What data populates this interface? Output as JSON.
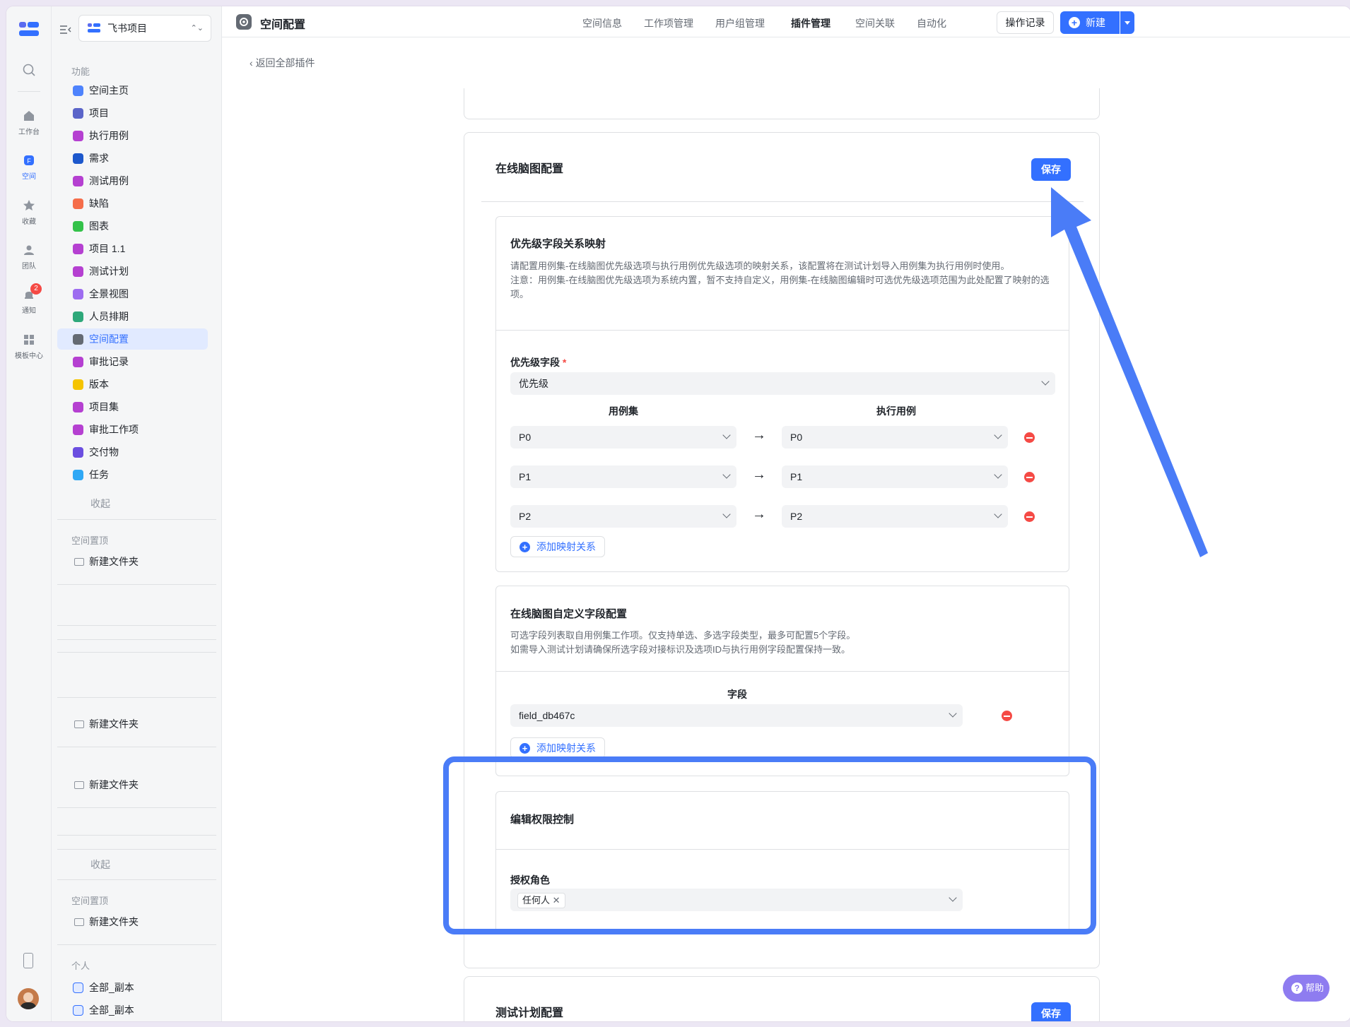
{
  "rail": {
    "items": [
      {
        "label": "工作台"
      },
      {
        "label": "空间"
      },
      {
        "label": "收藏"
      },
      {
        "label": "团队"
      },
      {
        "label": "通知"
      },
      {
        "label": "模板中心"
      }
    ],
    "notify_badge": "2"
  },
  "sidebar": {
    "project": "飞书项目",
    "section_label": "功能",
    "items": [
      {
        "label": "空间主页",
        "color": "#4e83fd"
      },
      {
        "label": "项目",
        "color": "#5b65c9"
      },
      {
        "label": "执行用例",
        "color": "#b540d1"
      },
      {
        "label": "需求",
        "color": "#1d58cc"
      },
      {
        "label": "测试用例",
        "color": "#b540d1"
      },
      {
        "label": "缺陷",
        "color": "#f56d4a"
      },
      {
        "label": "图表",
        "color": "#34c24a"
      },
      {
        "label": "项目 1.1",
        "color": "#b540d1"
      },
      {
        "label": "测试计划",
        "color": "#b540d1"
      },
      {
        "label": "全景视图",
        "color": "#9d6cf0"
      },
      {
        "label": "人员排期",
        "color": "#2ea87a"
      },
      {
        "label": "空间配置",
        "color": "#646a73"
      },
      {
        "label": "审批记录",
        "color": "#b540d1"
      },
      {
        "label": "版本",
        "color": "#f5c400"
      },
      {
        "label": "项目集",
        "color": "#b540d1"
      },
      {
        "label": "审批工作项",
        "color": "#b540d1"
      },
      {
        "label": "交付物",
        "color": "#6b4ee0"
      },
      {
        "label": "任务",
        "color": "#2fa8f5"
      }
    ],
    "collapse": "收起",
    "pinned_label": "空间置顶",
    "folder": "新建文件夹",
    "personal_label": "个人",
    "personal_items": [
      "全部_副本",
      "全部_副本"
    ]
  },
  "header": {
    "title": "空间配置",
    "tabs": [
      "空间信息",
      "工作项管理",
      "用户组管理",
      "插件管理",
      "空间关联",
      "自动化"
    ],
    "active_tab": "插件管理",
    "log_button": "操作记录",
    "new_button": "新建"
  },
  "back_link": "返回全部插件",
  "mindmap_card": {
    "title": "在线脑图配置",
    "save": "保存",
    "priority": {
      "title": "优先级字段关系映射",
      "desc1": "请配置用例集-在线脑图优先级选项与执行用例优先级选项的映射关系，该配置将在测试计划导入用例集为执行用例时使用。",
      "desc2": "注意：用例集-在线脑图优先级选项为系统内置，暂不支持自定义，用例集-在线脑图编辑时可选优先级选项范围为此处配置了映射的选项。",
      "field_label": "优先级字段",
      "field_value": "优先级",
      "col_left": "用例集",
      "col_right": "执行用例",
      "rows": [
        {
          "left": "P0",
          "right": "P0"
        },
        {
          "left": "P1",
          "right": "P1"
        },
        {
          "left": "P2",
          "right": "P2"
        }
      ],
      "add": "添加映射关系"
    },
    "custom": {
      "title": "在线脑图自定义字段配置",
      "desc1": "可选字段列表取自用例集工作项。仅支持单选、多选字段类型，最多可配置5个字段。",
      "desc2": "如需导入测试计划请确保所选字段对接标识及选项ID与执行用例字段配置保持一致。",
      "col": "字段",
      "field_value": "field_db467c",
      "add": "添加映射关系"
    },
    "permission": {
      "title": "编辑权限控制",
      "role_label": "授权角色",
      "tag": "任何人"
    }
  },
  "test_plan_card": {
    "title": "测试计划配置",
    "save": "保存"
  },
  "help": "帮助",
  "annotation_color": "#4a7cf7"
}
